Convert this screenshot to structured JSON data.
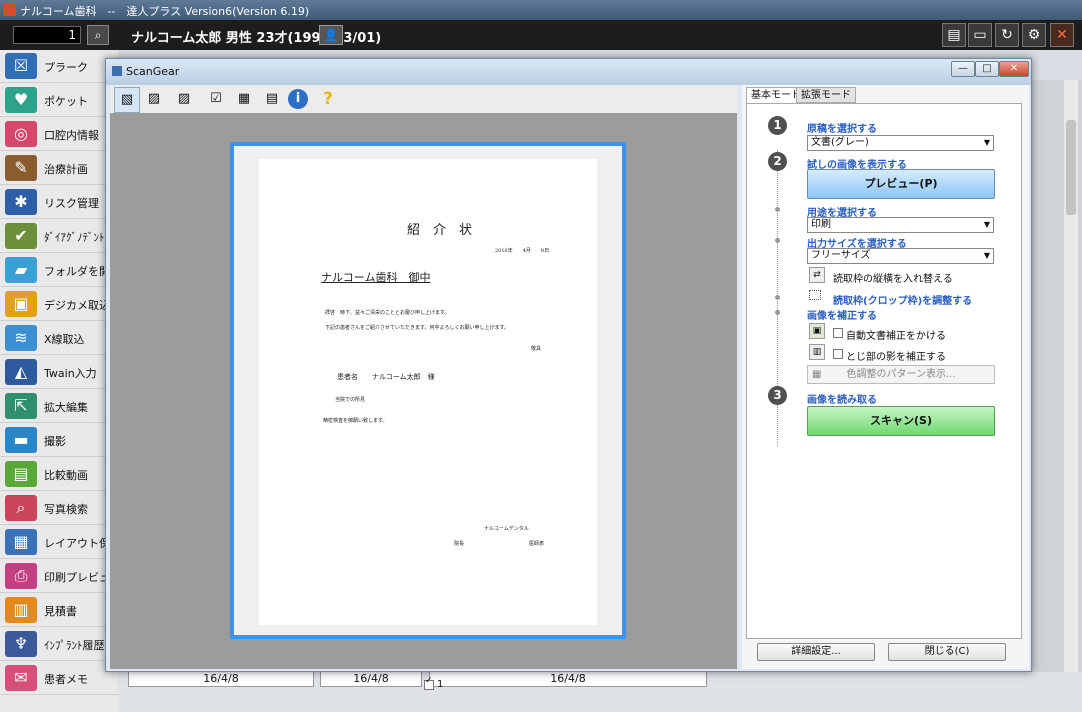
{
  "window": {
    "title": "ナルコーム歯科　--　達人プラス Version6(Version 6.19)"
  },
  "header": {
    "patient_id": "1",
    "patient_info": "ナルコーム太郎 男性 23才(1993/03/01)",
    "buttons": [
      "book-icon",
      "monitor-icon",
      "refresh-icon",
      "settings-icon",
      "close-icon"
    ]
  },
  "sidebar": {
    "items": [
      {
        "label": "プラーク",
        "color": "#2f6db4",
        "icon": "☒"
      },
      {
        "label": "ポケット",
        "color": "#2fa38a",
        "icon": "♥"
      },
      {
        "label": "口腔内情報",
        "color": "#d6476c",
        "icon": "◎"
      },
      {
        "label": "治療計画",
        "color": "#8a5c2e",
        "icon": "✎"
      },
      {
        "label": "リスク管理",
        "color": "#2d5ea8",
        "icon": "✱"
      },
      {
        "label": "ﾀﾞｲｱｸﾞﾉﾃﾞﾝﾄ",
        "color": "#6e8f3a",
        "icon": "✔"
      },
      {
        "label": "フォルダを開",
        "color": "#3aa0d6",
        "icon": "▰"
      },
      {
        "label": "デジカメ取込",
        "color": "#e0a020",
        "icon": "▣"
      },
      {
        "label": "X線取込",
        "color": "#3c8fd0",
        "icon": "≋"
      },
      {
        "label": "Twain入力",
        "color": "#2e5aa0",
        "icon": "◭"
      },
      {
        "label": "拡大編集",
        "color": "#2f8f6e",
        "icon": "⇱"
      },
      {
        "label": "撮影",
        "color": "#2a86c7",
        "icon": "▬"
      },
      {
        "label": "比較動画",
        "color": "#5aa83a",
        "icon": "▤"
      },
      {
        "label": "写真検索",
        "color": "#c8455a",
        "icon": "⌕"
      },
      {
        "label": "レイアウト保",
        "color": "#3a72b8",
        "icon": "▦"
      },
      {
        "label": "印刷プレビュ",
        "color": "#c04080",
        "icon": "⎙"
      },
      {
        "label": "見積書",
        "color": "#e08a20",
        "icon": "▥"
      },
      {
        "label": "ｲﾝﾌﾟﾗﾝﾄ履歴",
        "color": "#3a5a9a",
        "icon": "♆"
      },
      {
        "label": "患者メモ",
        "color": "#d8507a",
        "icon": "✉"
      }
    ]
  },
  "background": {
    "dates": [
      "16/4/8",
      "16/4/8",
      "16/4/8"
    ]
  },
  "scangear": {
    "title": "ScanGear",
    "toolbar_icons": [
      "scan-image-icon",
      "scan-zoom-icon",
      "scan-image-2-icon",
      "select-all-icon",
      "thumbnail-grid-icon",
      "thumbnail-list-icon",
      "info-icon",
      "help-icon"
    ],
    "document": {
      "heading": "紹　介　状",
      "date": "2016年　　4月　　8日",
      "addressee": "ナルコーム歯科　御中",
      "greeting": "拝啓　時下、益々ご清栄のこととお慶び申し上げます。",
      "body": "下記の患者さんをご紹介させていただきます。何卒よろしくお願い申し上げます。",
      "closing": "敬具",
      "patient_line": "患者名　　ナルコーム太郎　様",
      "finding": "当院での所見",
      "request": "精密検査を御願い致します。",
      "clinic": "ナルコームデンタル",
      "doctor_line": "院長　　　　　　　　　　　　　医師表",
      "page_number": "1"
    },
    "tabs": [
      "基本モード",
      "拡張モード"
    ],
    "panel": {
      "step1_num": "1",
      "step1": "原稿を選択する",
      "source_value": "文書(グレー)",
      "step2_num": "2",
      "step2": "試しの画像を表示する",
      "preview_button": "プレビュー(P)",
      "purpose_label": "用途を選択する",
      "purpose_value": "印刷",
      "output_label": "出力サイズを選択する",
      "output_value": "フリーサイズ",
      "swap_label": "読取枠の縦横を入れ替える",
      "crop_label": "読取枠(クロップ枠)を調整する",
      "correct_label": "画像を補正する",
      "auto_doc_label": "自動文書補正をかける",
      "gutter_label": "とじ部の影を補正する",
      "color_pattern_button": "色調整のパターン表示...",
      "step3_num": "3",
      "step3": "画像を読み取る",
      "scan_button": "スキャン(S)",
      "detail_button": "詳細設定...",
      "close_button": "閉じる(C)"
    }
  }
}
